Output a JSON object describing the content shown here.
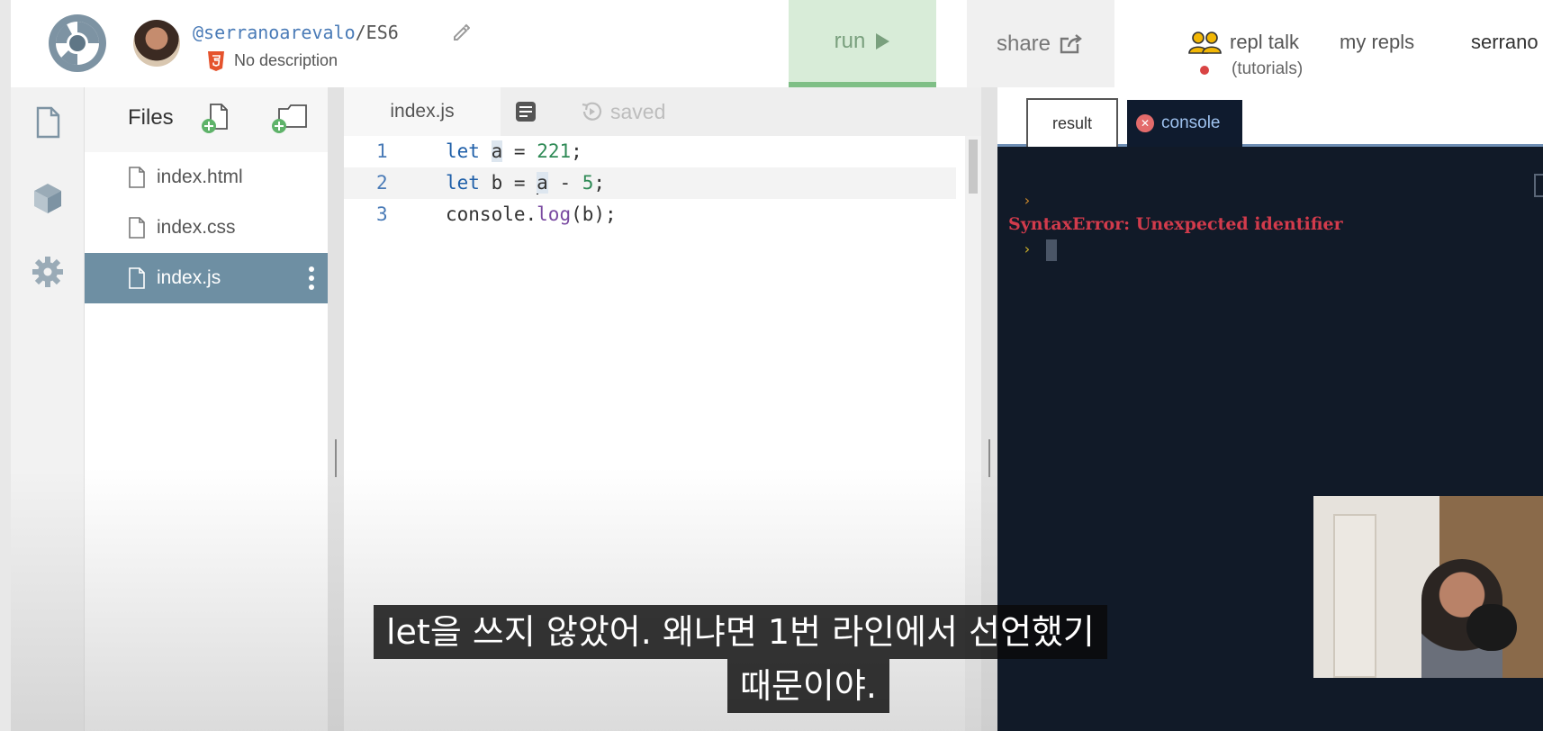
{
  "header": {
    "user": "@serranoarevalo",
    "separator": "/",
    "repl_name": "ES6",
    "description": "No description",
    "run_label": "run",
    "share_label": "share",
    "repl_talk_label": "repl talk",
    "repl_talk_sub": "(tutorials)",
    "my_repls_label": "my repls",
    "username": "serrano"
  },
  "files": {
    "title": "Files",
    "items": [
      {
        "name": "index.html"
      },
      {
        "name": "index.css"
      },
      {
        "name": "index.js"
      }
    ],
    "active_index": 2
  },
  "editor": {
    "tab_label": "index.js",
    "status": "saved",
    "lines": [
      {
        "number": "1",
        "text": "let a = 221;"
      },
      {
        "number": "2",
        "text": "let b = a - 5;"
      },
      {
        "number": "3",
        "text": "console.log(b);"
      }
    ]
  },
  "output": {
    "tabs": [
      {
        "label": "result"
      },
      {
        "label": "console"
      }
    ],
    "active_tab": "console",
    "prompt_symbol": "›",
    "error_message": "SyntaxError: Unexpected identifier"
  },
  "subtitles": {
    "line1": "let을 쓰지 않았어. 왜냐면 1번 라인에서 선언했기",
    "line2": "때문이야."
  },
  "colors": {
    "run_bg": "#d8ecd8",
    "active_file_bg": "#6e8fa3",
    "console_bg": "#111a28",
    "error_text": "#d23b4c"
  },
  "icons": {
    "logo": "replit-logo-icon",
    "edit": "pencil-icon",
    "language": "html5-icon",
    "run": "play-icon",
    "share": "share-icon",
    "talk": "people-icon",
    "rail": [
      "file-icon",
      "package-icon",
      "gear-icon"
    ],
    "new_file": "new-file-icon",
    "new_folder": "new-folder-icon",
    "file": "file-icon",
    "more": "kebab-icon",
    "format": "format-icon",
    "saved": "history-icon",
    "console_error": "error-x-icon"
  }
}
